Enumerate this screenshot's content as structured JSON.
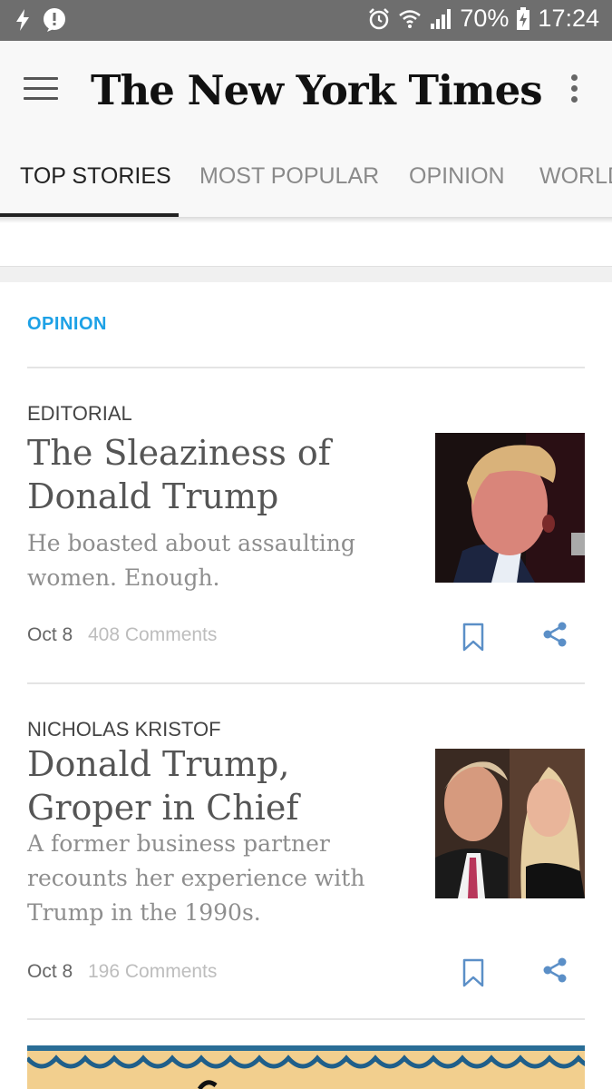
{
  "status_bar": {
    "battery": "70%",
    "time": "17:24",
    "icons": [
      "flash-icon",
      "notification-icon",
      "alarm-icon",
      "wifi-icon",
      "signal-icon",
      "battery-icon"
    ]
  },
  "app_bar": {
    "logo": "The New York Times",
    "menu_icon": "hamburger-menu-icon",
    "more_icon": "overflow-menu-icon"
  },
  "tabs": [
    {
      "label": "TOP STORIES",
      "active": true
    },
    {
      "label": "MOST POPULAR",
      "active": false
    },
    {
      "label": "OPINION",
      "active": false
    },
    {
      "label": "WORLD",
      "active": false
    }
  ],
  "section": {
    "label": "OPINION",
    "accent": "#1da1e6"
  },
  "articles": [
    {
      "kicker": "EDITORIAL",
      "headline": "The Sleaziness of Donald Trump",
      "summary": "He boasted about assaulting women. Enough.",
      "date": "Oct 8",
      "comments": "408 Comments"
    },
    {
      "kicker": "NICHOLAS KRISTOF",
      "headline": "Donald Trump, Groper in Chief",
      "summary": "A former business partner recounts her experience with Trump in the 1990s.",
      "date": "Oct 8",
      "comments": "196 Comments"
    }
  ],
  "colors": {
    "status_bar": "#6e6e6e",
    "app_bar": "#f8f8f8",
    "action_icon": "#5b8fc7"
  }
}
